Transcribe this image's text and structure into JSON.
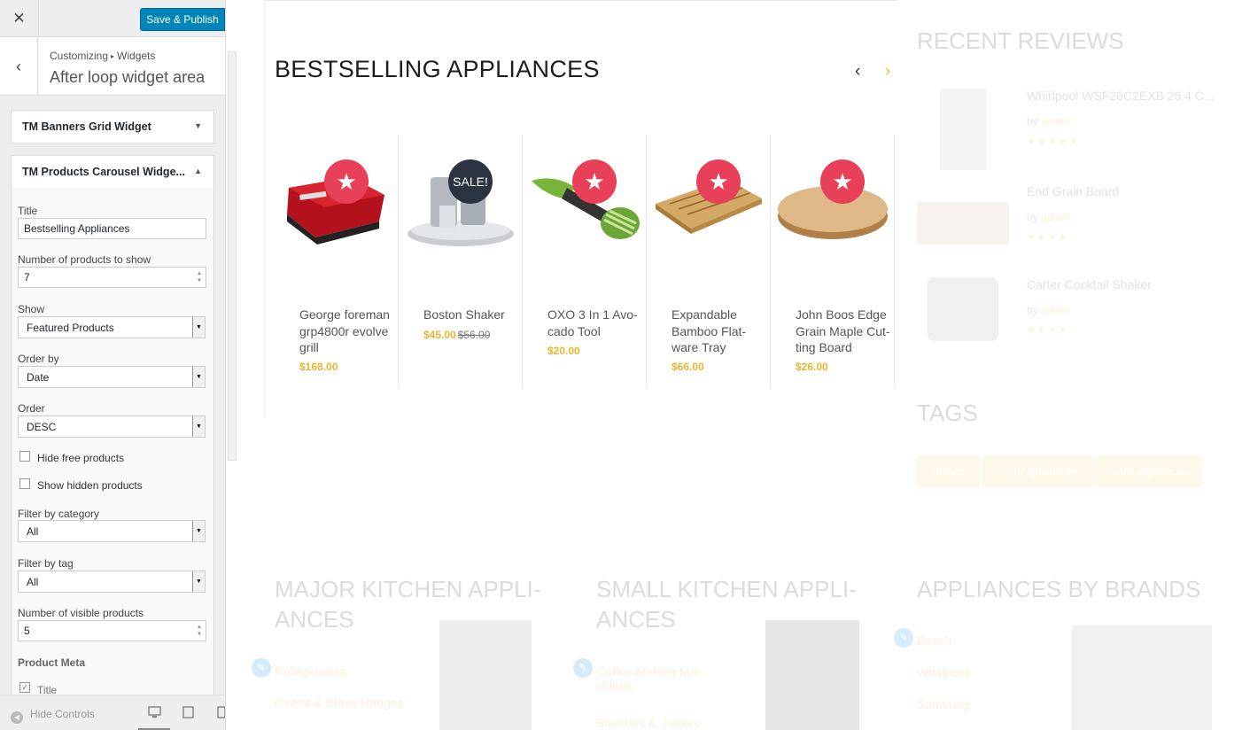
{
  "topbar": {
    "close_icon": "close-icon",
    "save_label": "Save & Publish",
    "accent": "#0085ba"
  },
  "section": {
    "crumb_a": "Customizing",
    "crumb_sep": "▸",
    "crumb_b": "Widgets",
    "title": "After loop widget area"
  },
  "widgets": {
    "banners": {
      "title": "TM Banners Grid Widget",
      "state": "collapsed"
    },
    "carousel": {
      "title": "TM Products Carousel Widge...",
      "state": "expanded"
    }
  },
  "form": {
    "title_label": "Title",
    "title_value": "Bestselling Appliances",
    "count_label": "Number of products to show",
    "count_value": "7",
    "show_label": "Show",
    "show_value": "Featured Products",
    "orderby_label": "Order by",
    "orderby_value": "Date",
    "order_label": "Order",
    "order_value": "DESC",
    "hide_free_label": "Hide free products",
    "hide_free_checked": false,
    "show_hidden_label": "Show hidden products",
    "show_hidden_checked": false,
    "cat_label": "Filter by category",
    "cat_value": "All",
    "tag_label": "Filter by tag",
    "tag_value": "All",
    "visible_label": "Number of visible products",
    "visible_value": "5",
    "meta_heading": "Product Meta",
    "meta_title_label": "Title",
    "meta_title_checked": true
  },
  "footer": {
    "hide_controls": "Hide Controls",
    "devices": [
      "desktop-icon",
      "tablet-icon",
      "mobile-icon"
    ],
    "active_device": "desktop-icon"
  },
  "preview": {
    "carousel_title": "BESTSELLING APPLIANCES",
    "prev": "‹",
    "next": "›",
    "products": [
      {
        "name": "George foreman grp4800r evolve grill",
        "price": "$168.00",
        "old_price": "",
        "badge": "★",
        "badge_type": "featured-star-icon"
      },
      {
        "name": "Boston Shaker",
        "price": "$45.00",
        "old_price": "$56.00",
        "badge": "SALE!",
        "badge_type": "sale-badge"
      },
      {
        "name": "OXO 3 In 1 Avo-cado Tool",
        "price": "$20.00",
        "old_price": "",
        "badge": "★",
        "badge_type": "featured-star-icon"
      },
      {
        "name": "Expandable Bamboo Flat-ware Tray",
        "price": "$66.00",
        "old_price": "",
        "badge": "★",
        "badge_type": "featured-star-icon"
      },
      {
        "name": "John Boos Edge Grain Maple Cut-ting Board",
        "price": "$26.00",
        "old_price": "",
        "badge": "★",
        "badge_type": "featured-star-icon"
      }
    ],
    "reviews_title": "RECENT REVIEWS",
    "reviews": [
      {
        "name": "Whirlpool WSF26C2EXB 26.4 C...",
        "by": "by",
        "author": "admin",
        "rating": 5
      },
      {
        "name": "End Grain Board",
        "by": "by",
        "author": "admin",
        "rating": 4
      },
      {
        "name": "Carter Cocktail Shaker",
        "by": "by",
        "author": "admin",
        "rating": 4
      }
    ],
    "tags_title": "TAGS",
    "tags": [
      "kitchen",
      "major appliances",
      "small appliances"
    ],
    "bottom_sections": [
      {
        "title": "MAJOR KITCHEN APPLI-ANCES",
        "links": [
          "Refrigerators",
          "Ovens & Stove Ranges"
        ]
      },
      {
        "title": "SMALL KITCHEN APPLI-ANCES",
        "links": [
          "Coffee Making Ma-chines",
          "Blenders & Juicers"
        ]
      },
      {
        "title": "APPLIANCES BY BRANDS",
        "links": [
          "Bosch",
          "Whirlpool",
          "Samsung"
        ]
      }
    ],
    "star_color": "#e74058",
    "price_color": "#e8b530"
  }
}
